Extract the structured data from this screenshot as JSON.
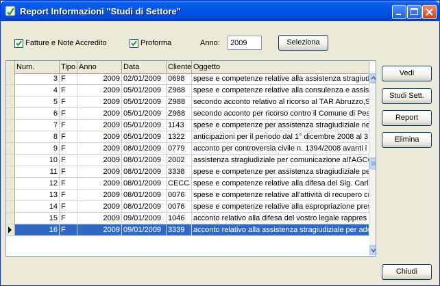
{
  "window": {
    "title": "Report Informazioni \"Studi di Settore\""
  },
  "filters": {
    "fatture_label": "Fatture e Note Accredito",
    "fatture_checked": true,
    "proforma_label": "Proforma",
    "proforma_checked": true,
    "anno_label": "Anno:",
    "anno_value": "2009",
    "seleziona_label": "Seleziona"
  },
  "table": {
    "columns": [
      "Num.",
      "Tipo",
      "Anno",
      "Data",
      "Cliente",
      "Oggetto"
    ],
    "rows": [
      [
        "3",
        "F",
        "2009",
        "02/01/2009",
        "0698",
        "spese e competenze relative alla assistenza stragiudiz"
      ],
      [
        "4",
        "F",
        "2009",
        "05/01/2009",
        "Z988",
        "spese e competenze relative alla consulenza e assiste"
      ],
      [
        "5",
        "F",
        "2009",
        "05/01/2009",
        "Z988",
        "secondo acconto relativo al ricorso al TAR Abruzzo,S"
      ],
      [
        "6",
        "F",
        "2009",
        "05/01/2009",
        "Z988",
        "secondo acconto per ricorso contro il Comune di Pes"
      ],
      [
        "7",
        "F",
        "2009",
        "05/01/2009",
        "1143",
        "spese e competenze per assistenza stragiudiziale nell"
      ],
      [
        "8",
        "F",
        "2009",
        "05/01/2009",
        "1322",
        "anticipazioni per il periodo dal 1° dicembre 2008 al 31"
      ],
      [
        "9",
        "F",
        "2009",
        "08/01/2009",
        "0779",
        "acconto per controversia civile n. 1394/2008 avanti i"
      ],
      [
        "10",
        "F",
        "2009",
        "08/01/2009",
        "2002",
        "assistenza stragiudiziale per comunicazione all'AGCO"
      ],
      [
        "11",
        "F",
        "2009",
        "08/01/2009",
        "3338",
        "spese e competenze per assistenza stragiudiziale per"
      ],
      [
        "12",
        "F",
        "2009",
        "08/01/2009",
        "CECC",
        "spese e competenze relative alla difesa del Sig. Carlo"
      ],
      [
        "13",
        "F",
        "2009",
        "08/01/2009",
        "0076",
        "spese e competenze relative all'attività di recupero  cr"
      ],
      [
        "14",
        "F",
        "2009",
        "08/01/2009",
        "0076",
        "spese e competenze relative alla espropriazione press"
      ],
      [
        "15",
        "F",
        "2009",
        "09/01/2009",
        "1046",
        "acconto relativo alla difesa del vostro legale rappres"
      ],
      [
        "16",
        "F",
        "2009",
        "09/01/2009",
        "3339",
        "acconto relativo alla assistenza stragiudiziale per ade"
      ]
    ],
    "selected_row": 13
  },
  "actions": {
    "vedi": "Vedi",
    "studi": "Studi Sett.",
    "report": "Report",
    "elimina": "Elimina",
    "chiudi": "Chiudi"
  },
  "colors": {
    "title_bar": "#0055e5",
    "selection": "#316ac5",
    "window_bg": "#ece9d8"
  }
}
